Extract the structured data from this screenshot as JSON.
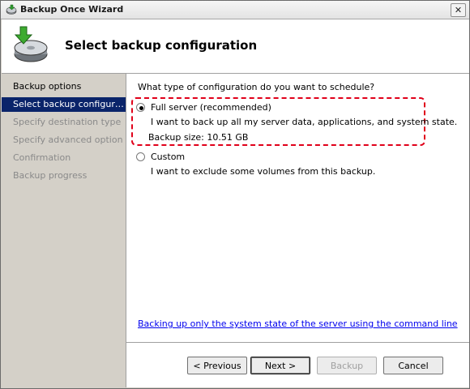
{
  "window": {
    "title": "Backup Once Wizard",
    "close_glyph": "✕"
  },
  "header": {
    "title": "Select backup configuration",
    "icon": "backup-disk-icon"
  },
  "sidebar": {
    "heading": "Backup options",
    "items": [
      {
        "label": "Select backup configur…",
        "selected": true
      },
      {
        "label": "Specify destination type",
        "selected": false
      },
      {
        "label": "Specify advanced option",
        "selected": false
      },
      {
        "label": "Confirmation",
        "selected": false
      },
      {
        "label": "Backup progress",
        "selected": false
      }
    ]
  },
  "content": {
    "question": "What type of configuration do you want to schedule?",
    "options": [
      {
        "label": "Full server (recommended)",
        "description": "I want to back up all my server data, applications, and system state.",
        "extra": "Backup size: 10.51 GB",
        "selected": true
      },
      {
        "label": "Custom",
        "description": "I want to exclude some volumes from this backup.",
        "selected": false
      }
    ],
    "link": "Backing up only the system state of the server using the command line"
  },
  "buttons": {
    "previous": "< Previous",
    "next": "Next >",
    "backup": "Backup",
    "cancel": "Cancel"
  },
  "colors": {
    "selection": "#0a246a",
    "highlight_border": "#e0001a",
    "link": "#0000ee"
  }
}
